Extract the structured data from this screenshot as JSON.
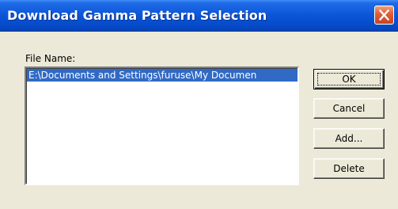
{
  "window": {
    "title": "Download Gamma Pattern Selection"
  },
  "file_list": {
    "label": "File Name:",
    "items": [
      "E:\\Documents and Settings\\furuse\\My Documen"
    ],
    "selected_index": 0
  },
  "buttons": {
    "ok": "OK",
    "cancel": "Cancel",
    "add": "Add...",
    "delete": "Delete"
  },
  "icons": {
    "close": "close-icon"
  },
  "colors": {
    "title_bar": "#0a55d8",
    "selection": "#316ac5",
    "dialog_bg": "#ece9d8",
    "close_button": "#e2603a"
  }
}
